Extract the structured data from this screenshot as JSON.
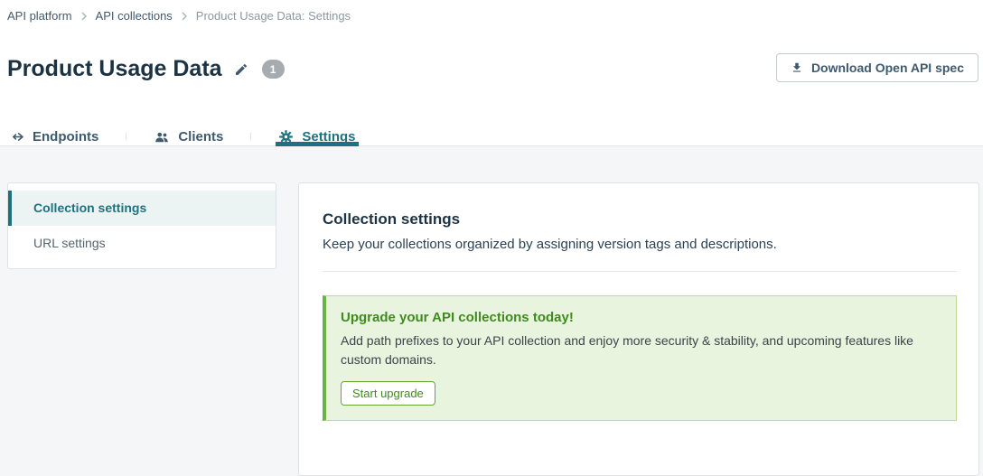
{
  "breadcrumb": {
    "items": [
      {
        "label": "API platform"
      },
      {
        "label": "API collections"
      },
      {
        "label": "Product Usage Data: Settings"
      }
    ]
  },
  "header": {
    "title": "Product Usage Data",
    "version_badge": "1",
    "download_button_label": "Download Open API spec"
  },
  "tabs": [
    {
      "label": "Endpoints",
      "icon": "endpoints-icon",
      "active": false
    },
    {
      "label": "Clients",
      "icon": "clients-icon",
      "active": false
    },
    {
      "label": "Settings",
      "icon": "gear-icon",
      "active": true
    }
  ],
  "sidebar": {
    "items": [
      {
        "label": "Collection settings",
        "active": true
      },
      {
        "label": "URL settings",
        "active": false
      }
    ]
  },
  "main": {
    "heading": "Collection settings",
    "description": "Keep your collections organized by assigning version tags and descriptions.",
    "upgrade_alert": {
      "title": "Upgrade your API collections today!",
      "body": "Add path prefixes to your API collection and enjoy more security & stability, and upcoming features like custom domains.",
      "button_label": "Start upgrade"
    }
  },
  "colors": {
    "accent_teal": "#1e7280",
    "heading_navy": "#1c3343",
    "tab_slate": "#3e5a6e",
    "alert_green_text": "#3f8b1f",
    "alert_green_border": "#6cb33f",
    "alert_green_bg": "#e9f4de",
    "content_bg": "#f4f6f8"
  }
}
